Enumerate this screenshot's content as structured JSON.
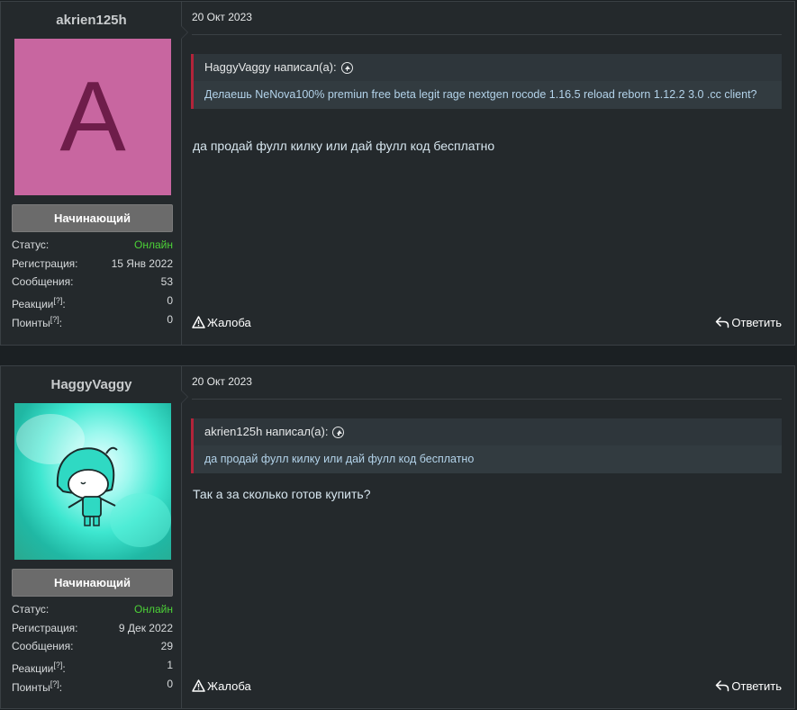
{
  "posts": [
    {
      "username": "akrien125h",
      "avatar_letter": "A",
      "avatar_color": "#c866a0",
      "rank": "Начинающий",
      "stats": {
        "status_label": "Статус:",
        "status_value": "Онлайн",
        "reg_label": "Регистрация:",
        "reg_value": "15 Янв 2022",
        "msg_label": "Сообщения:",
        "msg_value": "53",
        "react_label": "Реакции",
        "react_value": "0",
        "points_label": "Поинты",
        "points_value": "0",
        "help_mark": "[?]",
        "colon": ":"
      },
      "date": "20 Окт 2023",
      "quote_author": "HaggyVaggy написал(а):",
      "quote_text": "Делаешь NeNova100% premiun free beta legit rage nextgen rocode 1.16.5 reload reborn 1.12.2 3.0 .cc client?",
      "message": "да продай фулл килку или дай фулл код бесплатно",
      "report_label": "Жалоба",
      "reply_label": "Ответить"
    },
    {
      "username": "HaggyVaggy",
      "rank": "Начинающий",
      "stats": {
        "status_label": "Статус:",
        "status_value": "Онлайн",
        "reg_label": "Регистрация:",
        "reg_value": "9 Дек 2022",
        "msg_label": "Сообщения:",
        "msg_value": "29",
        "react_label": "Реакции",
        "react_value": "1",
        "points_label": "Поинты",
        "points_value": "0",
        "help_mark": "[?]",
        "colon": ":"
      },
      "date": "20 Окт 2023",
      "quote_author": "akrien125h написал(а):",
      "quote_text": "да продай фулл килку или дай фулл код бесплатно",
      "message": "Так а за сколько готов купить?",
      "report_label": "Жалоба",
      "reply_label": "Ответить"
    }
  ],
  "colors": {
    "online": "#4cd137",
    "quote_border": "#b3243a",
    "rank_bg": "#6b6b6b"
  }
}
